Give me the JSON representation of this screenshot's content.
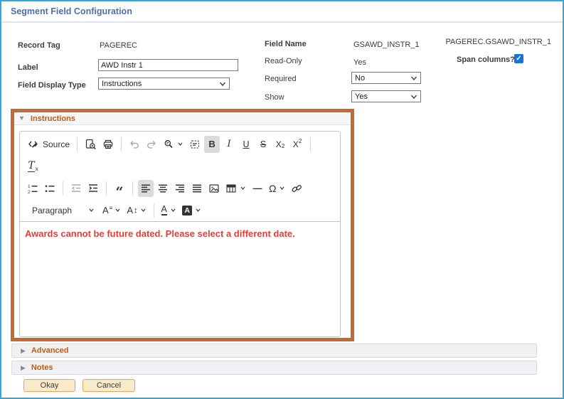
{
  "page": {
    "title": "Segment Field Configuration"
  },
  "form": {
    "record_tag_label": "Record Tag",
    "record_tag_value": "PAGEREC",
    "label_label": "Label",
    "label_value": "AWD Instr 1",
    "field_display_type_label": "Field Display Type",
    "field_display_type_value": "Instructions",
    "field_name_label": "Field Name",
    "field_name_value": "GSAWD_INSTR_1",
    "read_only_label": "Read-Only",
    "read_only_value": "Yes",
    "required_label": "Required",
    "required_value": "No",
    "show_label": "Show",
    "show_value": "Yes",
    "qualified_name": "PAGEREC.GSAWD_INSTR_1",
    "span_columns_label": "Span columns?:",
    "span_columns_checked": true
  },
  "sections": {
    "instructions": {
      "label": "Instructions",
      "expanded": true
    },
    "advanced": {
      "label": "Advanced",
      "expanded": false
    },
    "notes": {
      "label": "Notes",
      "expanded": false
    }
  },
  "editor": {
    "content": "Awards cannot be future dated. Please select a different date.",
    "toolbar_rows": [
      [
        {
          "name": "source",
          "label": "Source"
        },
        {
          "name": "separator"
        },
        {
          "name": "preview"
        },
        {
          "name": "print"
        },
        {
          "name": "separator"
        },
        {
          "name": "undo",
          "disabled": true
        },
        {
          "name": "redo",
          "disabled": true
        },
        {
          "name": "find-replace",
          "chevron": true
        },
        {
          "name": "select-all"
        },
        {
          "name": "bold",
          "active": true
        },
        {
          "name": "italic"
        },
        {
          "name": "underline"
        },
        {
          "name": "strikethrough"
        },
        {
          "name": "subscript"
        },
        {
          "name": "superscript"
        },
        {
          "name": "separator"
        }
      ],
      [
        {
          "name": "remove-format"
        }
      ],
      [
        {
          "name": "numbered-list"
        },
        {
          "name": "bulleted-list"
        },
        {
          "name": "separator"
        },
        {
          "name": "outdent",
          "disabled": true
        },
        {
          "name": "indent"
        },
        {
          "name": "separator"
        },
        {
          "name": "block-quote"
        },
        {
          "name": "separator"
        },
        {
          "name": "align-left",
          "active": true
        },
        {
          "name": "align-center"
        },
        {
          "name": "align-right"
        },
        {
          "name": "align-justify"
        },
        {
          "name": "image"
        },
        {
          "name": "table",
          "chevron": true
        },
        {
          "name": "horizontal-line"
        },
        {
          "name": "special-characters",
          "chevron": true
        },
        {
          "name": "link"
        }
      ],
      [
        {
          "name": "paragraph",
          "label": "Paragraph",
          "chevron": true,
          "dropdown": true
        },
        {
          "name": "font-family",
          "chevron": true
        },
        {
          "name": "font-size",
          "chevron": true
        },
        {
          "name": "separator"
        },
        {
          "name": "font-color",
          "chevron": true
        },
        {
          "name": "font-background-color",
          "chevron": true
        }
      ]
    ]
  },
  "buttons": {
    "okay": "Okay",
    "cancel": "Cancel"
  },
  "icons": {
    "triangle_down": "▼",
    "triangle_right": "▶",
    "checkmark": "✓"
  },
  "colors": {
    "page_border": "#2BA9E1",
    "title_text": "#4C6FAE",
    "highlight_border": "#C16A33",
    "section_label": "#C05C15",
    "error_text": "#DF403B",
    "checkbox_blue": "#1B73D3"
  }
}
